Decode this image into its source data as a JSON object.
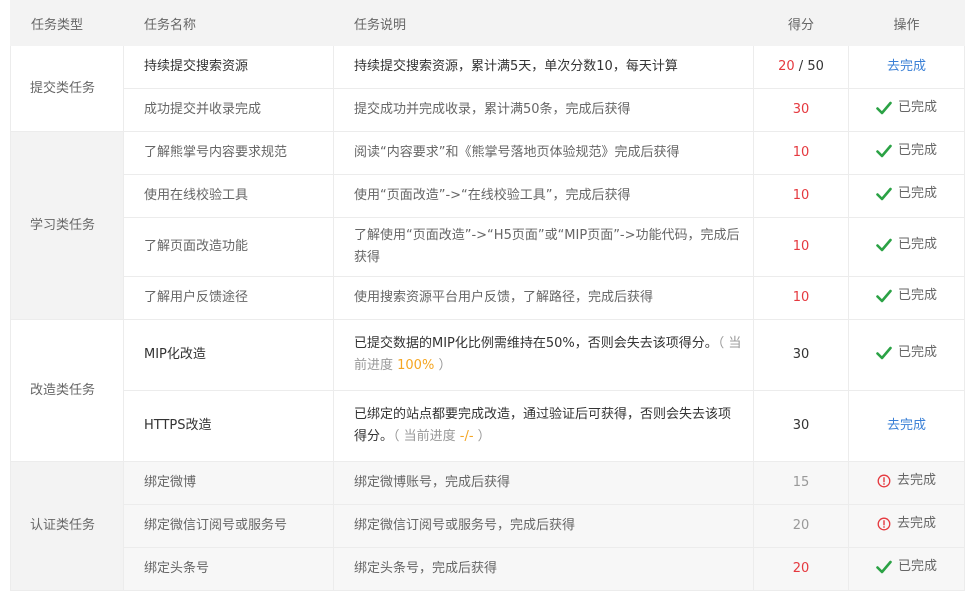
{
  "table": {
    "headers": {
      "type": "任务类型",
      "name": "任务名称",
      "desc": "任务说明",
      "score": "得分",
      "op": "操作"
    },
    "groups": [
      {
        "type": "提交类任务",
        "rows": [
          {
            "name": "持续提交搜索资源",
            "desc": "持续提交搜索资源，累计满5天，单次分数10，每天计算",
            "score_current": "20",
            "score_sep": "/",
            "score_total": "50",
            "op": "去完成"
          },
          {
            "name": "成功提交并收录完成",
            "desc": "提交成功并完成收录，累计满50条，完成后获得",
            "score": "30",
            "op": "已完成"
          }
        ]
      },
      {
        "type": "学习类任务",
        "rows": [
          {
            "name": "了解熊掌号内容要求规范",
            "desc": "阅读“内容要求”和《熊掌号落地页体验规范》完成后获得",
            "score": "10",
            "op": "已完成"
          },
          {
            "name": "使用在线校验工具",
            "desc": "使用“页面改造”->“在线校验工具”，完成后获得",
            "score": "10",
            "op": "已完成"
          },
          {
            "name": "了解页面改造功能",
            "desc": "了解使用“页面改造”->“H5页面”或“MIP页面”->功能代码，完成后获得",
            "score": "10",
            "op": "已完成"
          },
          {
            "name": "了解用户反馈途径",
            "desc": "使用搜索资源平台用户反馈，了解路径，完成后获得",
            "score": "10",
            "op": "已完成"
          }
        ]
      },
      {
        "type": "改造类任务",
        "rows": [
          {
            "name": "MIP化改造",
            "desc": "已提交数据的MIP化比例需维持在50%，否则会失去该项得分。",
            "hint_open": "（ 当前进度 ",
            "progress": "100%",
            "hint_close": " ）",
            "score": "30",
            "op": "已完成"
          },
          {
            "name": "HTTPS改造",
            "desc": "已绑定的站点都要完成改造，通过验证后可获得，否则会失去该项得分。",
            "hint_open": "（ 当前进度 ",
            "progress": "-/-",
            "hint_close": " ）",
            "score": "30",
            "op": "去完成"
          }
        ]
      },
      {
        "type": "认证类任务",
        "rows": [
          {
            "name": "绑定微博",
            "desc": "绑定微博账号，完成后获得",
            "score": "15",
            "op": "去完成"
          },
          {
            "name": "绑定微信订阅号或服务号",
            "desc": "绑定微信订阅号或服务号，完成后获得",
            "score": "20",
            "op": "去完成"
          },
          {
            "name": "绑定头条号",
            "desc": "绑定头条号，完成后获得",
            "score": "20",
            "op": "已完成"
          }
        ]
      }
    ]
  },
  "icons": {
    "check": "check-icon",
    "alert": "alert-icon"
  },
  "colors": {
    "check": "#2ba245",
    "alert": "#e5393f",
    "link": "#3b80d6",
    "score_red": "#e5393f",
    "progress": "#f5a623"
  }
}
